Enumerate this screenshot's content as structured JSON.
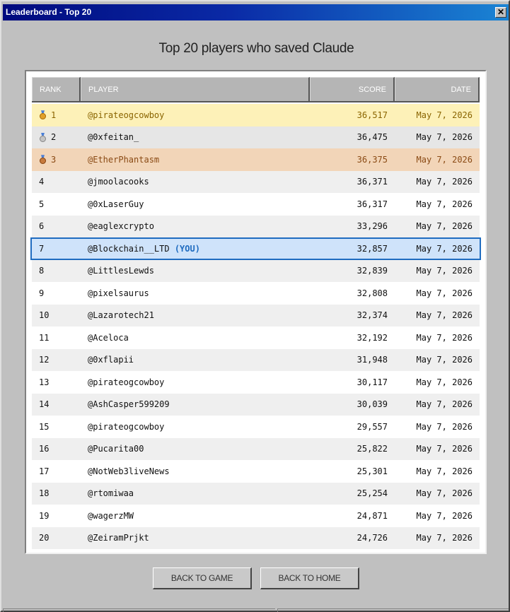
{
  "window": {
    "title": "Leaderboard - Top 20",
    "close_label": "✕"
  },
  "heading": "Top 20 players who saved Claude",
  "table": {
    "columns": [
      "RANK",
      "PLAYER",
      "SCORE",
      "DATE"
    ],
    "rows": [
      {
        "rank": "1",
        "player": "@pirateogcowboy",
        "score": "36,517",
        "date": "May 7, 2026",
        "medal": "gold"
      },
      {
        "rank": "2",
        "player": "@0xfeitan_",
        "score": "36,475",
        "date": "May 7, 2026",
        "medal": "silver"
      },
      {
        "rank": "3",
        "player": "@EtherPhantasm",
        "score": "36,375",
        "date": "May 7, 2026",
        "medal": "bronze"
      },
      {
        "rank": "4",
        "player": "@jmoolacooks",
        "score": "36,371",
        "date": "May 7, 2026"
      },
      {
        "rank": "5",
        "player": "@0xLaserGuy",
        "score": "36,317",
        "date": "May 7, 2026"
      },
      {
        "rank": "6",
        "player": "@eaglexcrypto",
        "score": "33,296",
        "date": "May 7, 2026"
      },
      {
        "rank": "7",
        "player": "@Blockchain__LTD",
        "tag": "(YOU)",
        "score": "32,857",
        "date": "May 7, 2026",
        "you": true
      },
      {
        "rank": "8",
        "player": "@LittlesLewds",
        "score": "32,839",
        "date": "May 7, 2026"
      },
      {
        "rank": "9",
        "player": "@pixelsaurus",
        "score": "32,808",
        "date": "May 7, 2026"
      },
      {
        "rank": "10",
        "player": "@Lazarotech21",
        "score": "32,374",
        "date": "May 7, 2026"
      },
      {
        "rank": "11",
        "player": "@Aceloca",
        "score": "32,192",
        "date": "May 7, 2026"
      },
      {
        "rank": "12",
        "player": "@0xflapii",
        "score": "31,948",
        "date": "May 7, 2026"
      },
      {
        "rank": "13",
        "player": "@pirateogcowboy",
        "score": "30,117",
        "date": "May 7, 2026"
      },
      {
        "rank": "14",
        "player": "@AshCasper599209",
        "score": "30,039",
        "date": "May 7, 2026"
      },
      {
        "rank": "15",
        "player": "@pirateogcowboy",
        "score": "29,557",
        "date": "May 7, 2026"
      },
      {
        "rank": "16",
        "player": "@Pucarita00",
        "score": "25,822",
        "date": "May 7, 2026"
      },
      {
        "rank": "17",
        "player": "@NotWeb3liveNews",
        "score": "25,301",
        "date": "May 7, 2026"
      },
      {
        "rank": "18",
        "player": "@rtomiwaa",
        "score": "25,254",
        "date": "May 7, 2026"
      },
      {
        "rank": "19",
        "player": "@wagerzMW",
        "score": "24,871",
        "date": "May 7, 2026"
      },
      {
        "rank": "20",
        "player": "@ZeiramPrjkt",
        "score": "24,726",
        "date": "May 7, 2026"
      }
    ]
  },
  "buttons": {
    "back_to_game": "BACK TO GAME",
    "back_to_home": "BACK TO HOME"
  },
  "colors": {
    "titlebar": "#000a7e",
    "you_highlight": "#1f6cc0",
    "gold_row": "#fdf1b8",
    "bronze_row": "#f2d5b8"
  }
}
